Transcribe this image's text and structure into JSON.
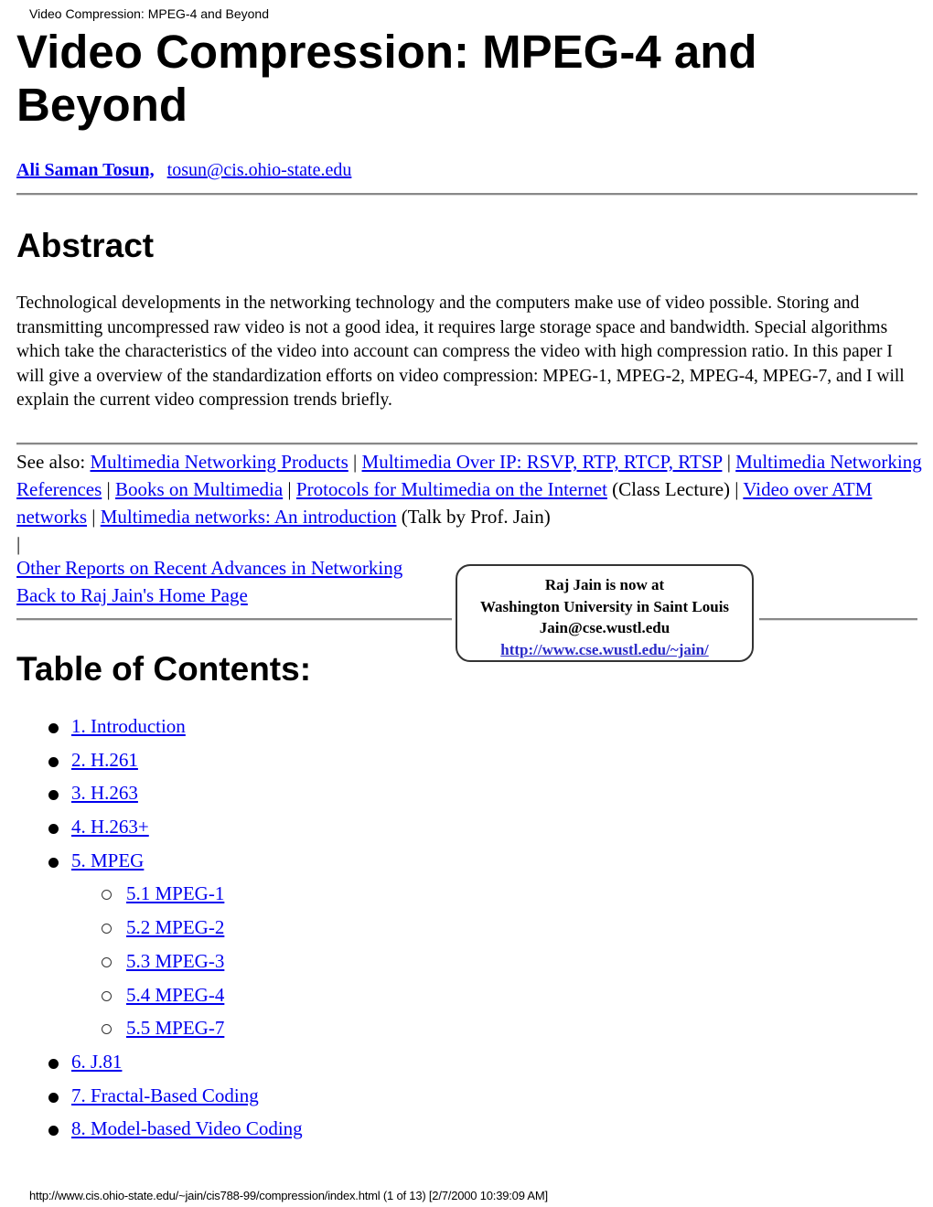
{
  "page_header": "Video Compression: MPEG-4 and Beyond",
  "title": "Video Compression: MPEG-4 and Beyond",
  "author": {
    "name": "Ali Saman Tosun,",
    "email": "tosun@cis.ohio-state.edu"
  },
  "abstract": {
    "heading": "Abstract",
    "text": "Technological developments in the networking technology and the computers make use of video possible. Storing and transmitting uncompressed raw video is not a good idea, it requires large storage space and bandwidth. Special algorithms which take the characteristics of the video into account can compress the video with high compression ratio. In this paper I will give a overview of the standardization efforts on video compression: MPEG-1, MPEG-2, MPEG-4, MPEG-7, and I will explain the current video compression trends briefly."
  },
  "see_also": {
    "prefix": "See also: ",
    "sep": " | ",
    "links": [
      "Multimedia Networking Products",
      "Multimedia Over IP: RSVP, RTP, RTCP, RTSP",
      "Multimedia Networking References",
      "Books on Multimedia",
      "Protocols for Multimedia on the Internet",
      "Video over ATM networks",
      "Multimedia networks: An introduction"
    ],
    "note_class_lecture": "(Class Lecture)",
    "note_talk": " (Talk by Prof. Jain)",
    "trailing_sep": "|"
  },
  "nav_links": [
    "Other Reports on Recent Advances in Networking",
    "Back to Raj Jain's Home Page"
  ],
  "notice": {
    "line1": "Raj Jain is now at",
    "line2": "Washington University in Saint Louis",
    "line3": "Jain@cse.wustl.edu",
    "link": "http://www.cse.wustl.edu/~jain/"
  },
  "toc": {
    "heading": "Table of Contents:",
    "items": [
      {
        "label": "1. Introduction",
        "level": 1
      },
      {
        "label": "2. H.261",
        "level": 1
      },
      {
        "label": "3. H.263",
        "level": 1
      },
      {
        "label": "4. H.263+",
        "level": 1
      },
      {
        "label": "5. MPEG",
        "level": 1
      },
      {
        "label": "5.1 MPEG-1",
        "level": 2
      },
      {
        "label": "5.2 MPEG-2",
        "level": 2
      },
      {
        "label": "5.3 MPEG-3",
        "level": 2
      },
      {
        "label": "5.4 MPEG-4",
        "level": 2
      },
      {
        "label": "5.5 MPEG-7",
        "level": 2
      },
      {
        "label": "6. J.81",
        "level": 1
      },
      {
        "label": "7. Fractal-Based Coding",
        "level": 1
      },
      {
        "label": "8. Model-based Video Coding",
        "level": 1
      }
    ]
  },
  "footer": "http://www.cis.ohio-state.edu/~jain/cis788-99/compression/index.html (1 of 13) [2/7/2000 10:39:09 AM]"
}
